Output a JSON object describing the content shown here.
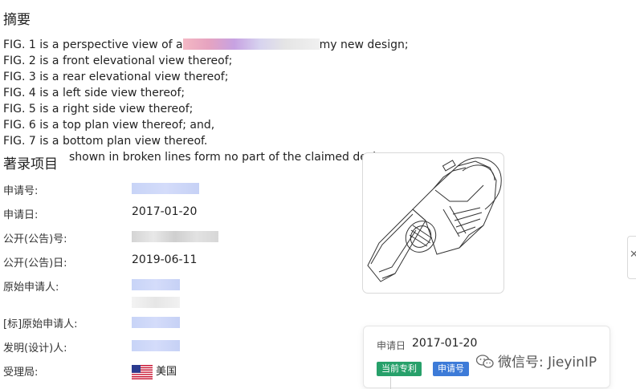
{
  "abstract": {
    "title": "摘要",
    "lines": [
      "FIG. 1 is a perspective view of a",
      "my new design;",
      "FIG. 2 is a front elevational view thereof;",
      "FIG. 3 is a rear elevational view thereof;",
      "FIG. 4 is a left side view thereof;",
      "FIG. 5 is a right side view thereof;",
      "FIG. 6 is a top plan view thereof; and,",
      "FIG. 7 is a bottom plan view thereof.",
      "shown in broken lines form no part of the claimed desig"
    ]
  },
  "bibliographic": {
    "title": "著录项目",
    "fields": [
      {
        "label": "申请号:",
        "value": ""
      },
      {
        "label": "申请日:",
        "value": "2017-01-20"
      },
      {
        "label": "公开(公告)号:",
        "value": ""
      },
      {
        "label": "公开(公告)日:",
        "value": "2019-06-11"
      },
      {
        "label": "原始申请人:",
        "value": ""
      },
      {
        "label": "[标]原始申请人:",
        "value": ""
      },
      {
        "label": "发明(设计)人:",
        "value": ""
      },
      {
        "label": "受理局:",
        "value": "美国"
      }
    ]
  },
  "popup": {
    "label": "申请日",
    "date": "2017-01-20",
    "tags": [
      "当前专利",
      "申请号"
    ],
    "watermark": "微信号: JieyinIP"
  },
  "edge_tab": {
    "glyph": "✕"
  },
  "colors": {
    "tag_green": "#27a06a",
    "tag_blue": "#3d7bd8"
  }
}
